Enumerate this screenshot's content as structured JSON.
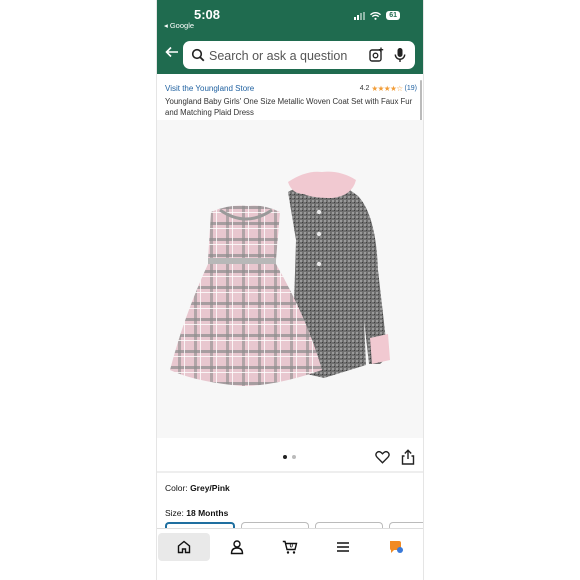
{
  "status_bar": {
    "time": "5:08",
    "back_app": "◂ Google",
    "battery": "61"
  },
  "search": {
    "placeholder": "Search or ask a question"
  },
  "product": {
    "store_link": "Visit the Youngland Store",
    "rating": "4.2",
    "stars": "★★★★☆",
    "rating_count": "(19)",
    "title": "Youngland Baby Girls' One Size Metallic Woven Coat Set with Faux Fur and Matching Plaid Dress"
  },
  "carousel": {
    "active_index": 1,
    "total": 2
  },
  "options": {
    "color_label": "Color:",
    "color_value": "Grey/Pink",
    "size_label": "Size:",
    "size_value": "18 Months"
  },
  "tabbar": {
    "items": [
      {
        "name": "home",
        "icon": "home-icon",
        "active": true
      },
      {
        "name": "account",
        "icon": "person-icon"
      },
      {
        "name": "cart",
        "icon": "cart-icon",
        "badge": "0"
      },
      {
        "name": "menu",
        "icon": "menu-icon"
      },
      {
        "name": "rufus",
        "icon": "rufus-icon"
      }
    ]
  },
  "colors": {
    "header": "#1f6b4f",
    "link": "#2162a1",
    "star": "#f29d38"
  }
}
